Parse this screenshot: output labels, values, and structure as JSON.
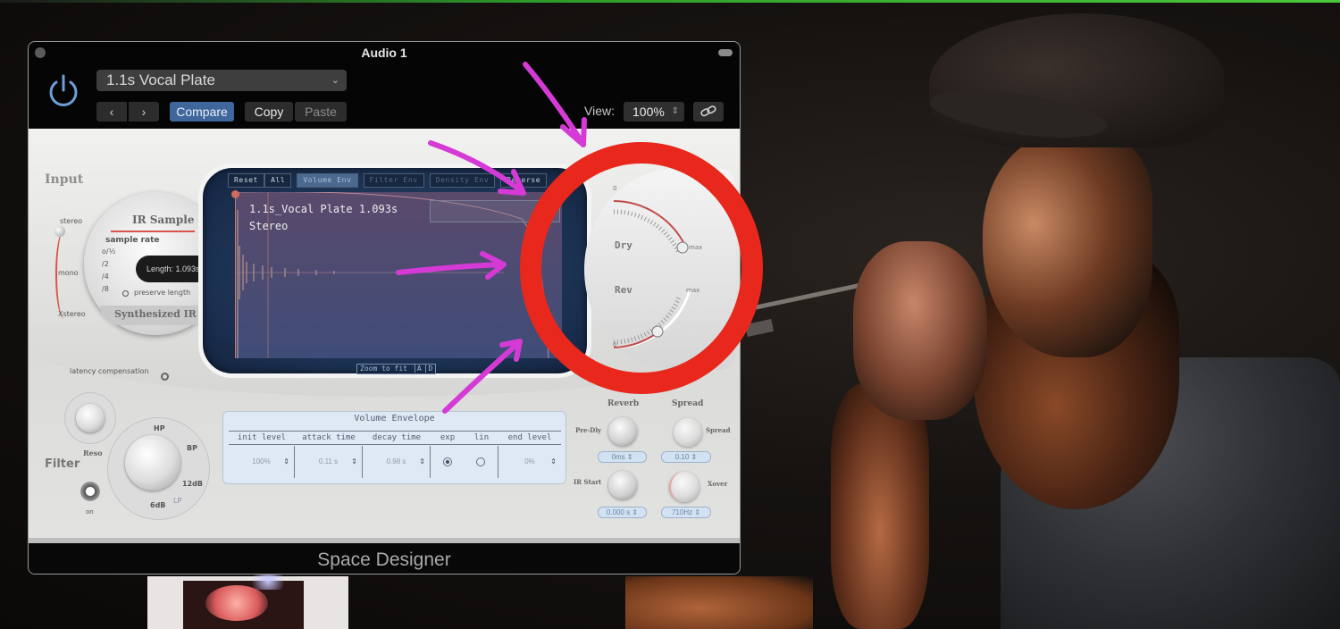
{
  "window": {
    "title": "Audio 1",
    "plugin_name": "Space Designer"
  },
  "header": {
    "preset": "1.1s Vocal Plate",
    "prev_label": "‹",
    "next_label": "›",
    "compare_label": "Compare",
    "copy_label": "Copy",
    "paste_label": "Paste",
    "view_label": "View:",
    "view_value": "100%",
    "link_icon": "⛓"
  },
  "input": {
    "label": "Input",
    "stereo": "stereo",
    "mono": "mono",
    "xstereo": "Xstereo",
    "latency": "latency compensation"
  },
  "ir": {
    "ir_sample_label": "IR Sample",
    "sample_rate_label": "sample rate",
    "rates": [
      "o/½",
      "/2",
      "/4",
      "/8"
    ],
    "length_text": "Length: 1.093s",
    "preserve_length": "preserve length",
    "synth_label": "Synthesized IR"
  },
  "display": {
    "tabs": [
      {
        "label": "Reset",
        "state": "normal"
      },
      {
        "label": "All",
        "state": "normal"
      },
      {
        "label": "Volume Env",
        "state": "active"
      },
      {
        "label": "Filter Env",
        "state": "dim"
      },
      {
        "label": "Density Env",
        "state": "dim"
      },
      {
        "label": "Reverse",
        "state": "normal"
      }
    ],
    "ir_name": "1.1s_Vocal Plate 1.093s",
    "channel": "Stereo",
    "zoom_fit": "Zoom to fit",
    "zoom_a": "A",
    "zoom_d": "D"
  },
  "mix": {
    "dry_label": "Dry",
    "rev_label": "Rev",
    "zero": "0",
    "max": "max",
    "dry_level": 1.0,
    "rev_level": 0.45
  },
  "envelope": {
    "title": "Volume Envelope",
    "columns": [
      "init level",
      "attack time",
      "decay time",
      "exp",
      "lin",
      "end level"
    ],
    "init_level": "100%",
    "attack_time": "0.11 s",
    "decay_time": "0.98 s",
    "curve": "exp",
    "end_level": "0%"
  },
  "reverb": {
    "section": "Reverb",
    "predly_label": "Pre-Dly",
    "predly_value": "0ms",
    "irstart_label": "IR Start",
    "irstart_value": "0.000 s"
  },
  "spread": {
    "section": "Spread",
    "spread_label": "Spread",
    "spread_value": "0.10",
    "xover_label": "Xover",
    "xover_value": "710Hz"
  },
  "filter": {
    "label": "Filter",
    "reso_label": "Reso",
    "on_label": "on",
    "modes": [
      "HP",
      "BP",
      "12dB",
      "6dB",
      "LP"
    ]
  },
  "annotation_colors": {
    "circle": "#e8281c",
    "arrows": "#d63ad6"
  }
}
